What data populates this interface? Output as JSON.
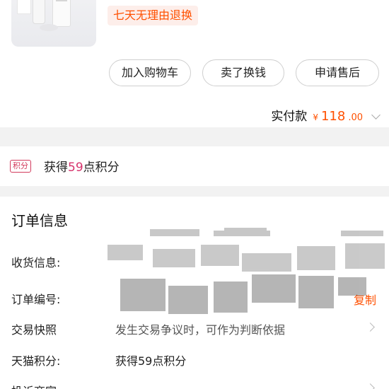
{
  "product": {
    "return_policy": "七天无理由退换"
  },
  "actions": {
    "add_cart": "加入购物车",
    "sell_exchange": "卖了换钱",
    "after_sale": "申请售后"
  },
  "payment": {
    "label": "实付款",
    "currency": "¥",
    "amount_int": "118",
    "amount_dec": ".00"
  },
  "points": {
    "badge": "积分",
    "text_prefix": "获得",
    "value": "59",
    "text_suffix": "点积分"
  },
  "order_info": {
    "title": "订单信息",
    "receiver_label": "收货信息:",
    "order_no_label": "订单编号:",
    "copy": "复制",
    "snapshot_label": "交易快照",
    "snapshot_value": "发生交易争议时，可作为判断依据",
    "tmall_points_label": "天猫积分:",
    "tmall_points_value": "获得59点积分",
    "complain_label": "投诉商家"
  },
  "colors": {
    "accent": "#ff5000",
    "points_pink": "#d6336c"
  }
}
